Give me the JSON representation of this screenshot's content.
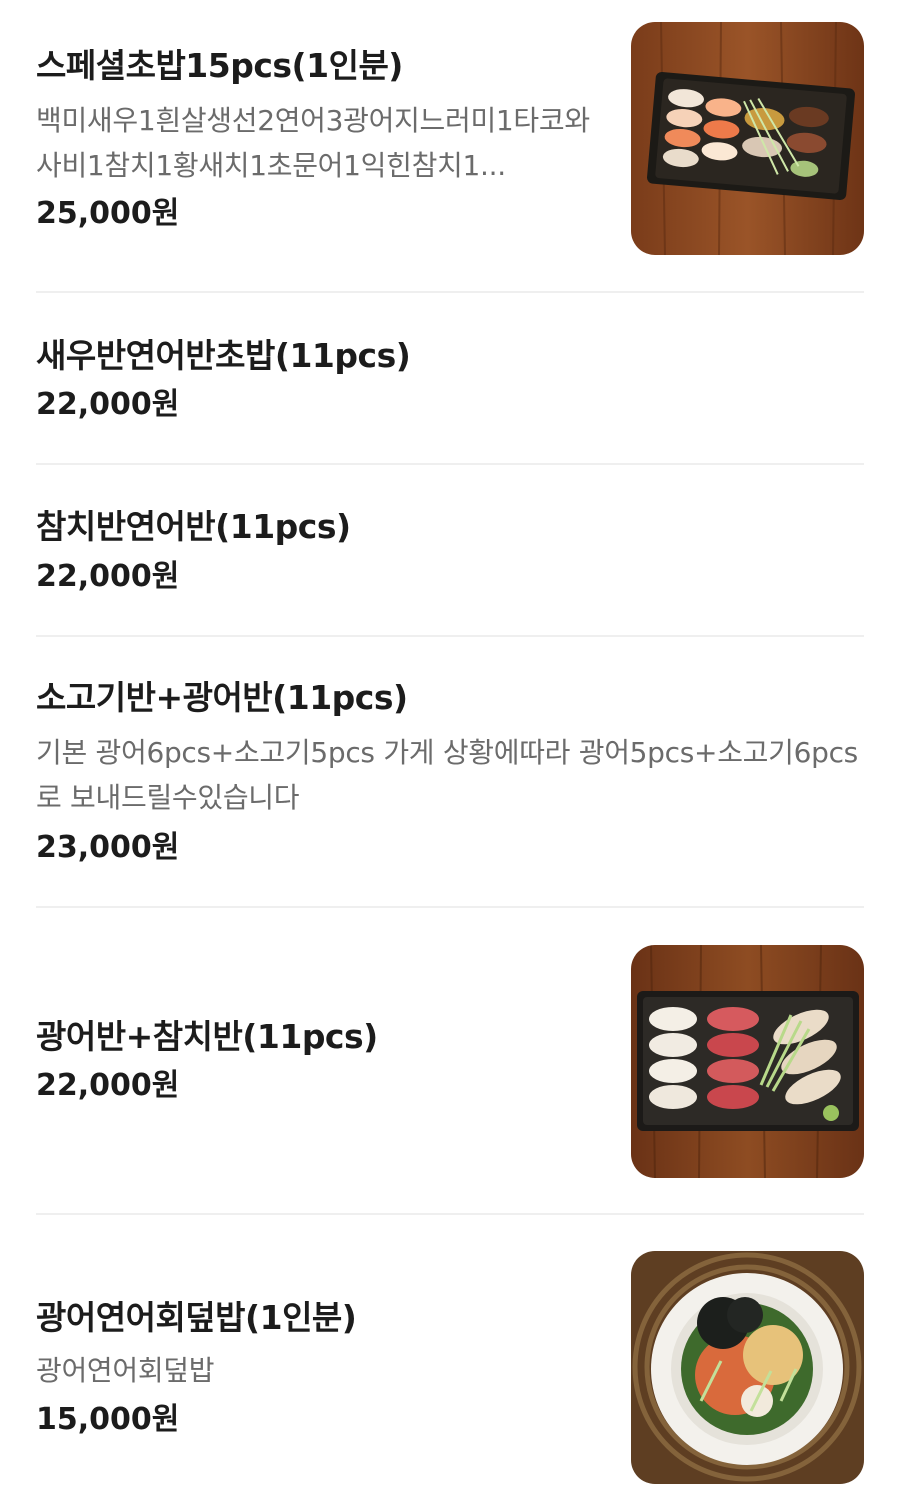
{
  "menu": {
    "items": [
      {
        "name": "스페셜초밥15pcs(1인분)",
        "description": "백미새우1흰살생선2연어3광어지느러미1타코와사비1참치1황새치1초문어1익힌참치1...",
        "price": "25,000원",
        "image": "sushi-platter-photo"
      },
      {
        "name": "새우반연어반초밥(11pcs)",
        "price": "22,000원"
      },
      {
        "name": "참치반연어반(11pcs)",
        "price": "22,000원"
      },
      {
        "name": "소고기반+광어반(11pcs)",
        "description": "기본 광어6pcs+소고기5pcs 가게 상황에따라 광어5pcs+소고기6pcs 로 보내드릴수있습니다",
        "price": "23,000원"
      },
      {
        "name": "광어반+참치반(11pcs)",
        "price": "22,000원",
        "image": "flatfish-tuna-sushi-photo"
      },
      {
        "name": "광어연어회덮밥(1인분)",
        "description": "광어연어회덮밥",
        "price": "15,000원",
        "image": "raw-fish-rice-bowl-photo"
      }
    ]
  },
  "colors": {
    "title": "#1c1c1c",
    "description": "#6b6b6b",
    "divider": "#efefef",
    "wood": "#8a4a22"
  }
}
